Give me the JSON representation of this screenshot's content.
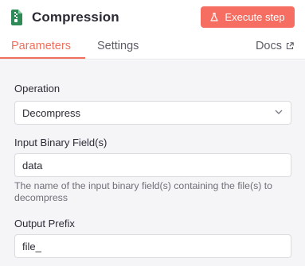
{
  "header": {
    "title": "Compression",
    "execute_label": "Execute step",
    "tabs": [
      {
        "label": "Parameters",
        "active": true
      },
      {
        "label": "Settings",
        "active": false
      }
    ],
    "docs_label": "Docs",
    "accent_color": "#f0705d"
  },
  "form": {
    "operation": {
      "label": "Operation",
      "value": "Decompress"
    },
    "input_binary": {
      "label": "Input Binary Field(s)",
      "value": "data",
      "hint": "The name of the input binary field(s) containing the file(s) to decompress"
    },
    "output_prefix": {
      "label": "Output Prefix",
      "value": "file_"
    }
  },
  "icons": [
    "file-archive-icon",
    "flask-icon",
    "external-link-icon",
    "chevron-down-icon"
  ]
}
